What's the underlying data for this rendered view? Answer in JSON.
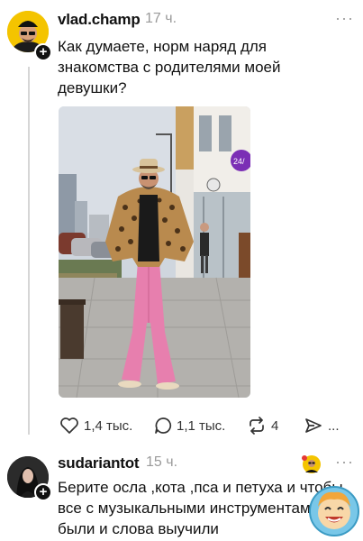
{
  "post": {
    "username": "vlad.champ",
    "time": "17 ч.",
    "more": "···",
    "text": "Как думаете, норм наряд для знакомства с родителями моей девушки?",
    "actions": {
      "likes": "1,4 тыс.",
      "replies": "1,1 тыс.",
      "reposts": "4",
      "share_more": "..."
    },
    "photo": {
      "sign_text": "24/"
    }
  },
  "reply": {
    "username": "sudariantot",
    "time": "15 ч.",
    "more": "···",
    "text": "Берите осла ,кота ,пса и петуха и чтобы все с музыкальными инструментами были и слова выучили"
  },
  "colors": {
    "accent_purple": "#7b2fb5",
    "avatar_yellow": "#f4c400",
    "pink_trousers": "#e77fae"
  },
  "icons": [
    "plus-icon",
    "heart-icon",
    "comment-icon",
    "repost-icon",
    "share-icon",
    "more-icon"
  ]
}
